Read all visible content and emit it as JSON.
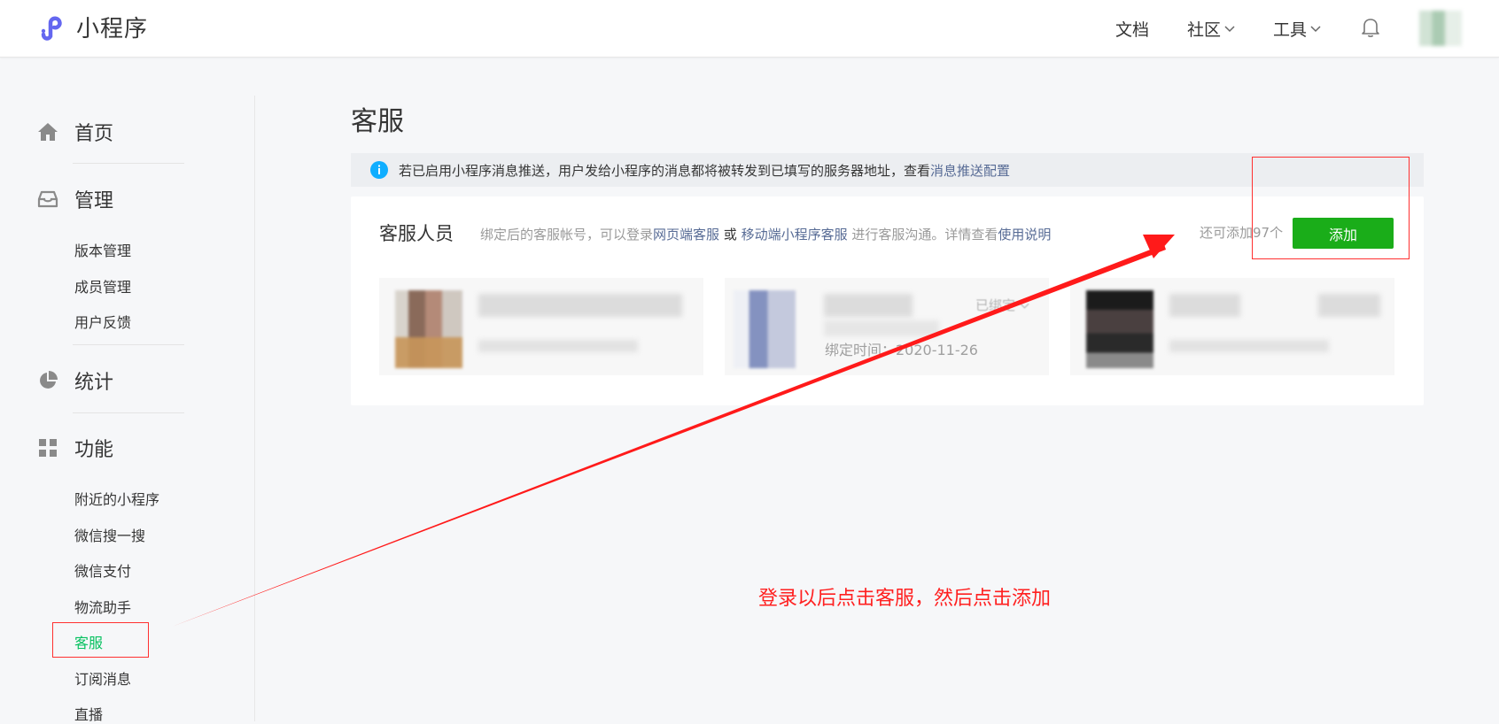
{
  "topnav": {
    "brand": "小程序",
    "docs": "文档",
    "community": "社区",
    "tools": "工具"
  },
  "sidebar": {
    "sections": [
      {
        "label": "首页",
        "icon": "home-icon"
      },
      {
        "label": "管理",
        "icon": "inbox-icon"
      },
      {
        "label": "统计",
        "icon": "pie-chart-icon"
      },
      {
        "label": "功能",
        "icon": "grid-icon"
      }
    ],
    "manage_items": [
      "版本管理",
      "成员管理",
      "用户反馈"
    ],
    "feature_items": [
      "附近的小程序",
      "微信搜一搜",
      "微信支付",
      "物流助手",
      "客服",
      "订阅消息",
      "直播"
    ],
    "active_item": "客服"
  },
  "main": {
    "title": "客服",
    "notice": {
      "text": "若已启用小程序消息推送，用户发给小程序的消息都将被转发到已填写的服务器地址，查看 ",
      "link": "消息推送配置"
    },
    "panel": {
      "title": "客服人员",
      "desc_1": "绑定后的客服帐号，可以登录",
      "link_web": "网页端客服",
      "desc_or": " 或 ",
      "link_mobile": "移动端小程序客服",
      "desc_2": " 进行客服沟通。详情查看",
      "link_help": "使用说明",
      "remaining": "还可添加97个",
      "add_label": "添加"
    },
    "agents": [
      {
        "status": "",
        "bind_time": ""
      },
      {
        "status": "已绑定",
        "bind_time": "绑定时间：2020-11-26"
      },
      {
        "status": "",
        "bind_time": ""
      }
    ]
  },
  "annotation": {
    "text": "登录以后点击客服，然后点击添加",
    "color": "#ff2020"
  },
  "colors": {
    "accent_green": "#1aad19",
    "active_green": "#07c160",
    "link_blue": "#576b95"
  }
}
